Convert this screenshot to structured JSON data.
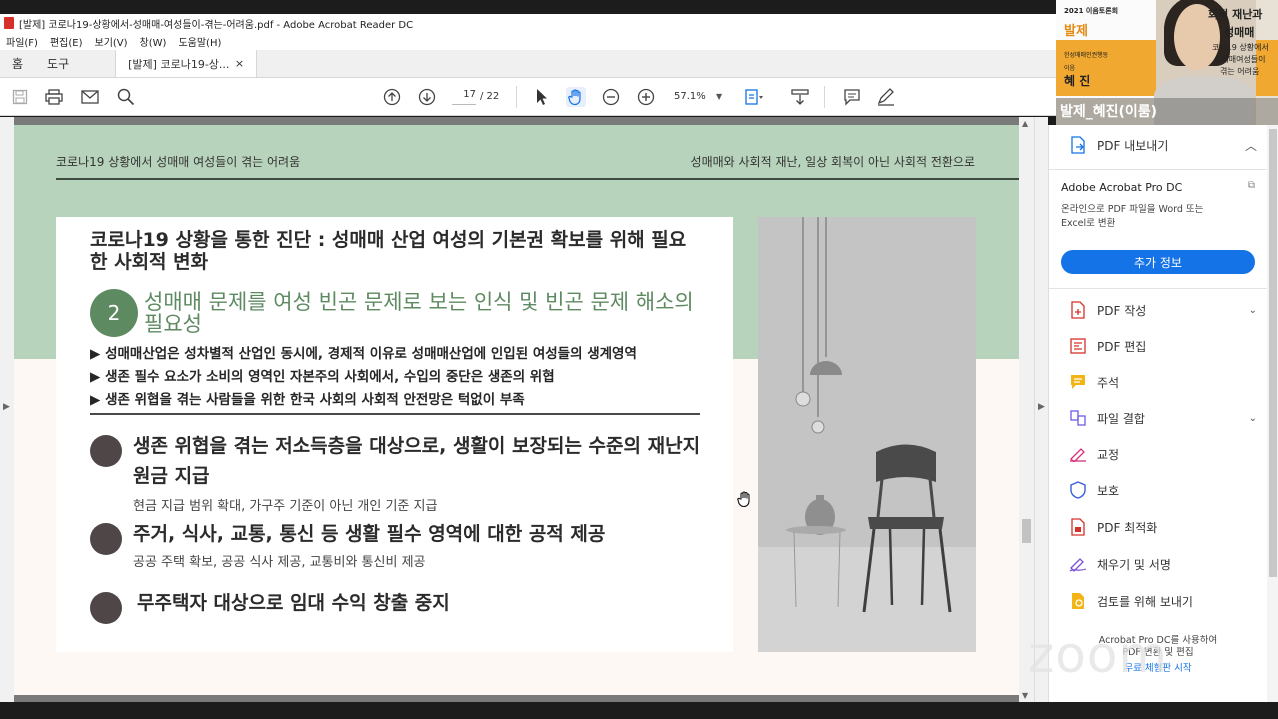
{
  "window": {
    "title": "[발제] 코로나19-상황에서-성매매-여성들이-겪는-어려움.pdf - Adobe Acrobat Reader DC"
  },
  "menu": [
    "파일(F)",
    "편집(E)",
    "보기(V)",
    "창(W)",
    "도움말(H)"
  ],
  "tabs": {
    "home": "홈",
    "tools": "도구",
    "doc": "[발제] 코로나19-상...",
    "close": "×"
  },
  "toolbar": {
    "page_current": "17",
    "page_total": "/ 22",
    "zoom": "57.1%"
  },
  "pdf": {
    "header_left": "코로나19 상황에서 성매매 여성들이 겪는 어려움",
    "header_right": "성매매와 사회적 재난, 일상 회복이 아닌 사회적 전환으로",
    "card_title": "코로나19 상황을 통한 진단 : 성매매 산업 여성의 기본권 확보를 위해 필요한 사회적 변화",
    "section_number": "2",
    "section_title": "성매매 문제를 여성 빈곤 문제로 보는 인식 및 빈곤 문제 해소의 필요성",
    "bullets": [
      "▶ 성매매산업은 성차별적 산업인 동시에, 경제적 이유로 성매매산업에 인입된 여성들의 생계영역",
      "▶ 생존 필수 요소가 소비의 영역인 자본주의 사회에서, 수입의 중단은 생존의 위협",
      "▶ 생존 위협을 겪는 사람들을 위한 한국 사회의 사회적 안전망은 턱없이 부족"
    ],
    "items": [
      {
        "main": "생존 위협을 겪는 저소득층을 대상으로, 생활이 보장되는 수준의 재난지원금 지급",
        "sub": "현금 지급 범위 확대, 가구주 기준이 아닌 개인 기준 지급"
      },
      {
        "main": "주거, 식사, 교통, 통신 등 생활 필수 영역에 대한 공적 제공",
        "sub": "공공 주택 확보, 공공 식사 제공, 교통비와 통신비 제공"
      },
      {
        "main": "무주택자 대상으로 임대 수익 창출 중지",
        "sub": ""
      }
    ]
  },
  "right_panel": {
    "export_label": "PDF 내보내기",
    "promo_title": "Adobe Acrobat Pro DC",
    "promo_desc": "온라인으로 PDF 파일을 Word 또는 Excel로 변환",
    "promo_button": "추가 정보",
    "tools": [
      "PDF 작성",
      "PDF 편집",
      "주석",
      "파일 결합",
      "교정",
      "보호",
      "PDF 최적화",
      "채우기 및 서명",
      "검토를 위해 보내기"
    ],
    "bottom_line1": "Acrobat Pro DC를 사용하여",
    "bottom_line2": "PDF 변환 및 편집",
    "bottom_link": "무료 체험판 시작"
  },
  "video": {
    "slide_year": "2021 이음토론회",
    "slide_label": "발제",
    "slide_org": "한성매매인권행동",
    "slide_role": "이음",
    "slide_name": "혜 진",
    "slide_right1": "회적 재난과",
    "slide_right2": "성매매",
    "slide_right3": "코나19 상황에서",
    "slide_right4": "성매매여성들이",
    "slide_right5": "겪는 어려움",
    "participant": "발제_혜진(이룸)"
  },
  "watermark": "zoom",
  "colors": {
    "pdf_accent_green": "#5e8a62",
    "pdf_header_green": "#b7d3bc",
    "acrobat_blue": "#1473e6",
    "acrobat_red": "#d6302a"
  }
}
